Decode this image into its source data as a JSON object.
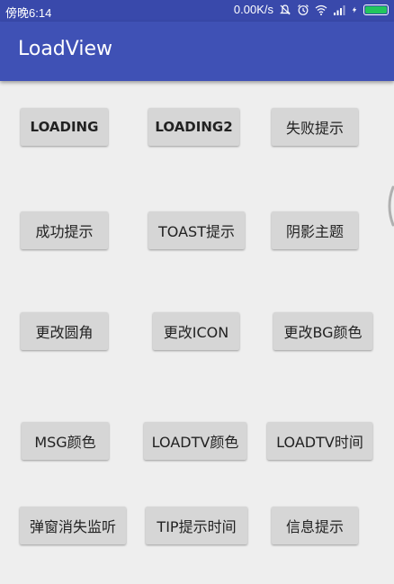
{
  "status_bar": {
    "time": "傍晚6:14",
    "speed": "0.00K/s",
    "icons": [
      "mute-icon",
      "alarm-icon",
      "wifi-icon",
      "signal-icon",
      "charging-icon",
      "battery-icon"
    ],
    "battery_color": "#22c55e"
  },
  "app_bar": {
    "title": "LoadView",
    "color": "#3f51b5"
  },
  "buttons": {
    "loading": "LOADING",
    "loading2": "LOADING2",
    "fail_tip": "失败提示",
    "success_tip": "成功提示",
    "toast_tip": "TOAST提示",
    "shadow_theme": "阴影主题",
    "change_radius": "更改圆角",
    "change_icon": "更改ICON",
    "change_bg_color": "更改BG颜色",
    "msg_color": "MSG颜色",
    "loadtv_color": "LOADTV颜色",
    "loadtv_time": "LOADTV时间",
    "dialog_dismiss_listener": "弹窗消失监听",
    "tip_time": "TIP提示时间",
    "info_tip": "信息提示"
  }
}
